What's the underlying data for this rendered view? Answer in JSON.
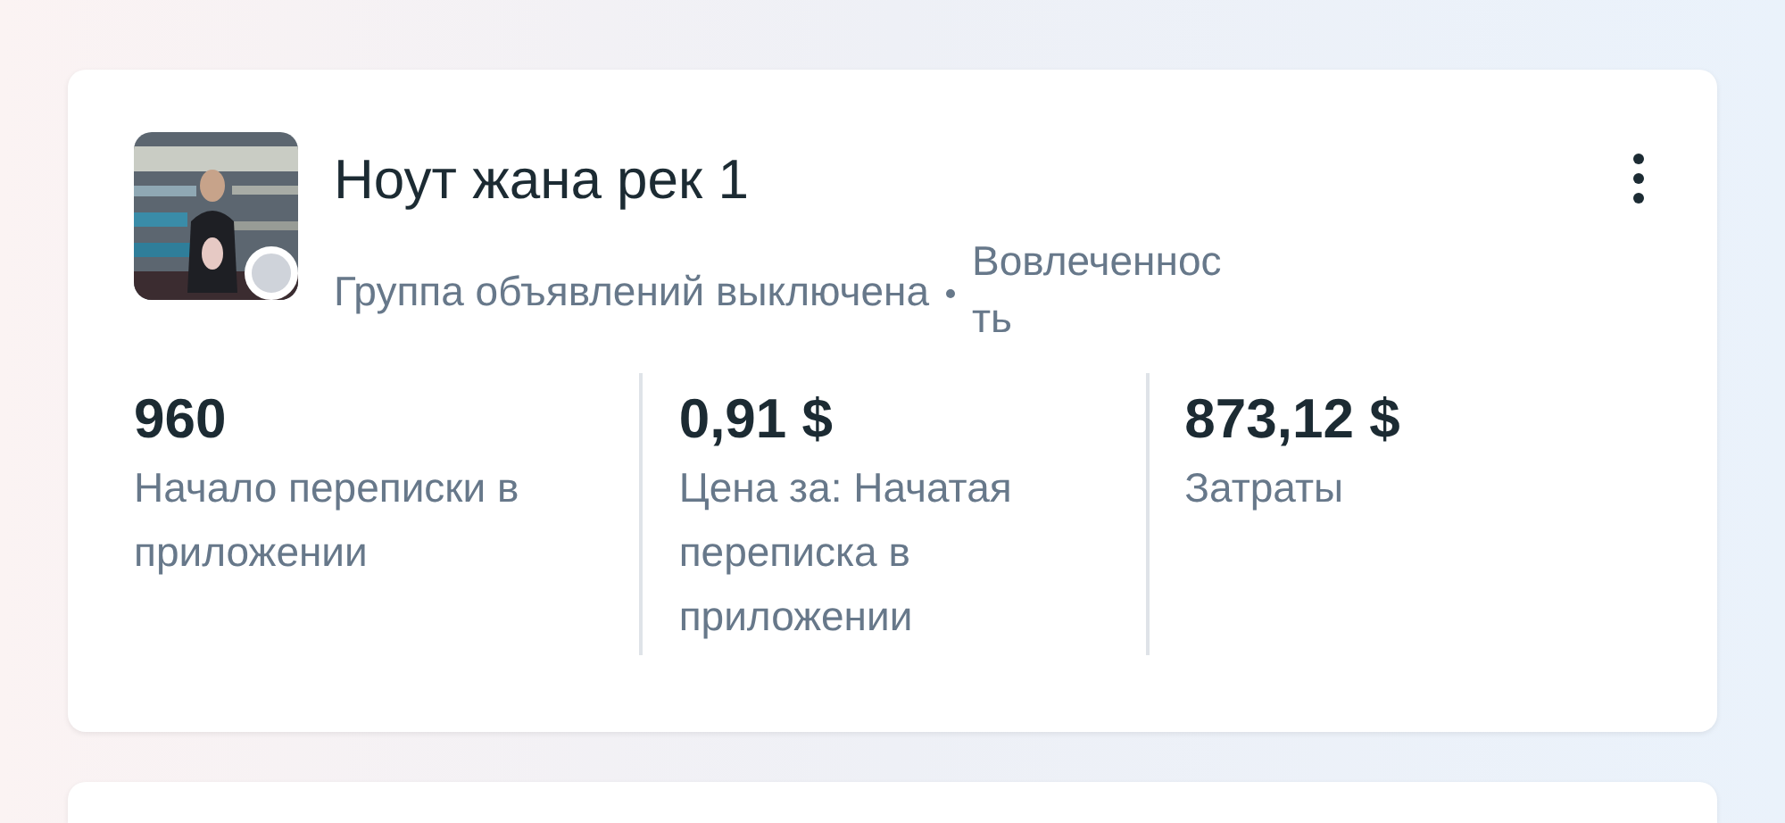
{
  "ad_set": {
    "title": "Ноут жана рек 1",
    "active": false,
    "status": "Группа объявлений выключена",
    "objective": "Вовлеченность",
    "metrics": [
      {
        "value": "960",
        "label": "Начало переписки в приложении"
      },
      {
        "value": "0,91 $",
        "label": "Цена за: Начатая переписка в приложении"
      },
      {
        "value": "873,12 $",
        "label": "Затраты"
      }
    ]
  }
}
